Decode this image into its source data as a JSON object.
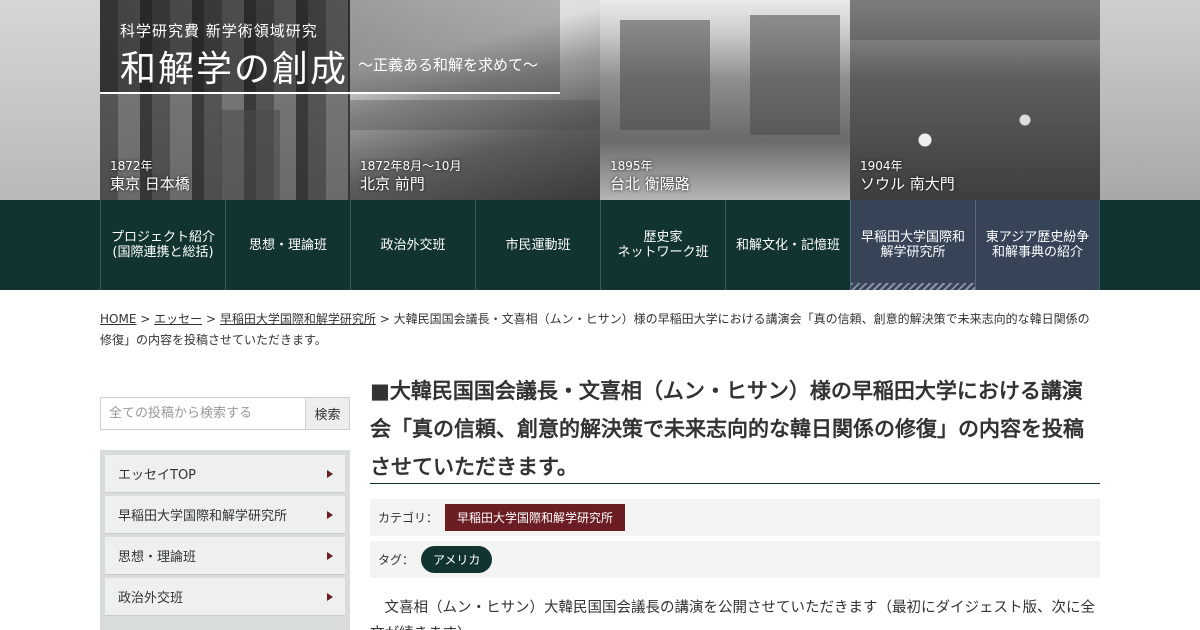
{
  "header": {
    "program": "科学研究費 新学術領域研究",
    "title": "和解学の創成",
    "tagline": "〜正義ある和解を求めて〜",
    "photos": [
      {
        "year": "1872年",
        "place": "東京 日本橋"
      },
      {
        "year": "1872年8月〜10月",
        "place": "北京 前門"
      },
      {
        "year": "1895年",
        "place": "台北 衡陽路"
      },
      {
        "year": "1904年",
        "place": "ソウル 南大門"
      }
    ]
  },
  "nav": {
    "items": [
      {
        "label": "プロジェクト紹介\n(国際連携と総括)"
      },
      {
        "label": "思想・理論班"
      },
      {
        "label": "政治外交班"
      },
      {
        "label": "市民運動班"
      },
      {
        "label": "歴史家\nネットワーク班"
      },
      {
        "label": "和解文化・記憶班"
      },
      {
        "label": "早稲田大学国際和解学研究所"
      },
      {
        "label": "東アジア歴史紛争和解事典の紹介"
      }
    ]
  },
  "breadcrumb": {
    "home": "HOME",
    "sep": ">",
    "essay": "エッセー",
    "institute": "早稲田大学国際和解学研究所",
    "current": "大韓民国国会議長・文喜相（ムン・ヒサン）様の早稲田大学における講演会「真の信頼、創意的解決策で未来志向的な韓日関係の修復」の内容を投稿させていただきます。"
  },
  "search": {
    "placeholder": "全ての投稿から検索する",
    "button": "検索"
  },
  "sidebar": {
    "items": [
      {
        "label": "エッセイTOP"
      },
      {
        "label": "早稲田大学国際和解学研究所"
      },
      {
        "label": "思想・理論班"
      },
      {
        "label": "政治外交班"
      }
    ]
  },
  "article": {
    "title": "■大韓民国国会議長・文喜相（ムン・ヒサン）様の早稲田大学における講演会「真の信頼、創意的解決策で未来志向的な韓日関係の修復」の内容を投稿させていただきます。",
    "category_label": "カテゴリ：",
    "category": "早稲田大学国際和解学研究所",
    "tag_label": "タグ：",
    "tag": "アメリカ",
    "body": "文喜相（ムン・ヒサン）大韓民国国会議長の講演を公開させていただきます（最初にダイジェスト版、次に全文が続きます）。"
  },
  "colors": {
    "nav_bg": "#123431",
    "nav_alt": "#374458",
    "category_badge": "#6b1d23",
    "tag_badge": "#123431",
    "arrow": "#6b1d23"
  }
}
